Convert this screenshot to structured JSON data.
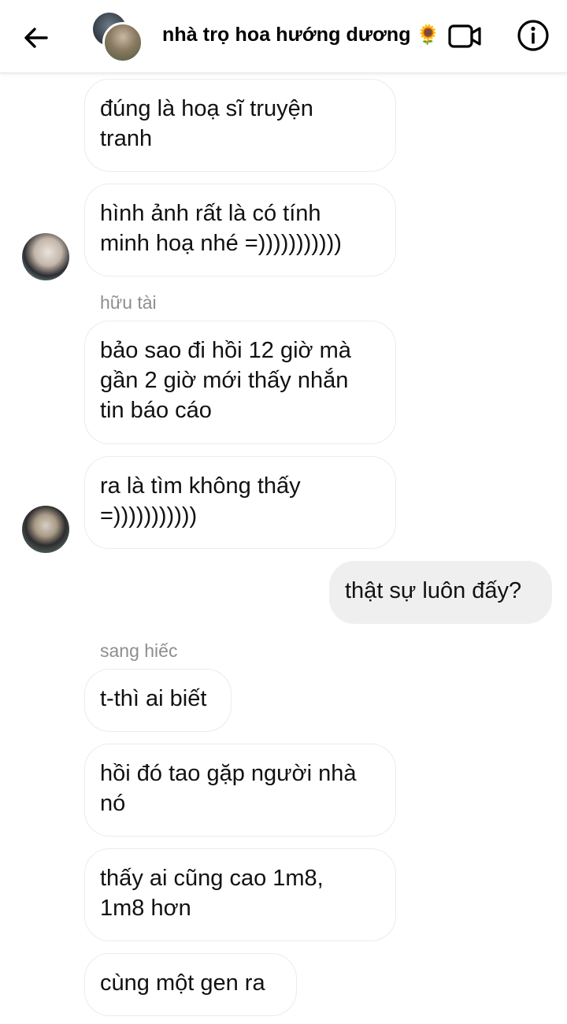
{
  "header": {
    "title": "nhà trọ hoa hướng dương",
    "emoji": "🌻"
  },
  "messages": [
    {
      "text": "đúng là hoạ sĩ truyện\ntranh"
    },
    {
      "text": "hình ảnh rất là có tính\nminh hoạ nhé =)))))))))))"
    },
    {
      "sender": "hữu tài"
    },
    {
      "text": "bảo sao đi hồi 12 giờ mà\ngần 2 giờ mới thấy nhắn\ntin báo cáo"
    },
    {
      "text": "ra là tìm không thấy\n=)))))))))))"
    },
    {
      "text": "thật sự luôn đấy?"
    },
    {
      "sender": "sang hiếc"
    },
    {
      "text": "t-thì ai biết"
    },
    {
      "text": "hồi đó tao gặp người nhà\nnó"
    },
    {
      "text": "thấy ai cũng cao 1m8,\n1m8 hơn"
    },
    {
      "text": "cùng một gen ra"
    }
  ],
  "colors": {
    "received_bubble": "#ffffff",
    "sent_bubble": "#efefef",
    "bubble_border": "#ebebeb",
    "sender_name": "#8e8e8e"
  },
  "icons": {
    "back": "arrow-left-icon",
    "video": "video-camera-icon",
    "info": "info-icon"
  }
}
